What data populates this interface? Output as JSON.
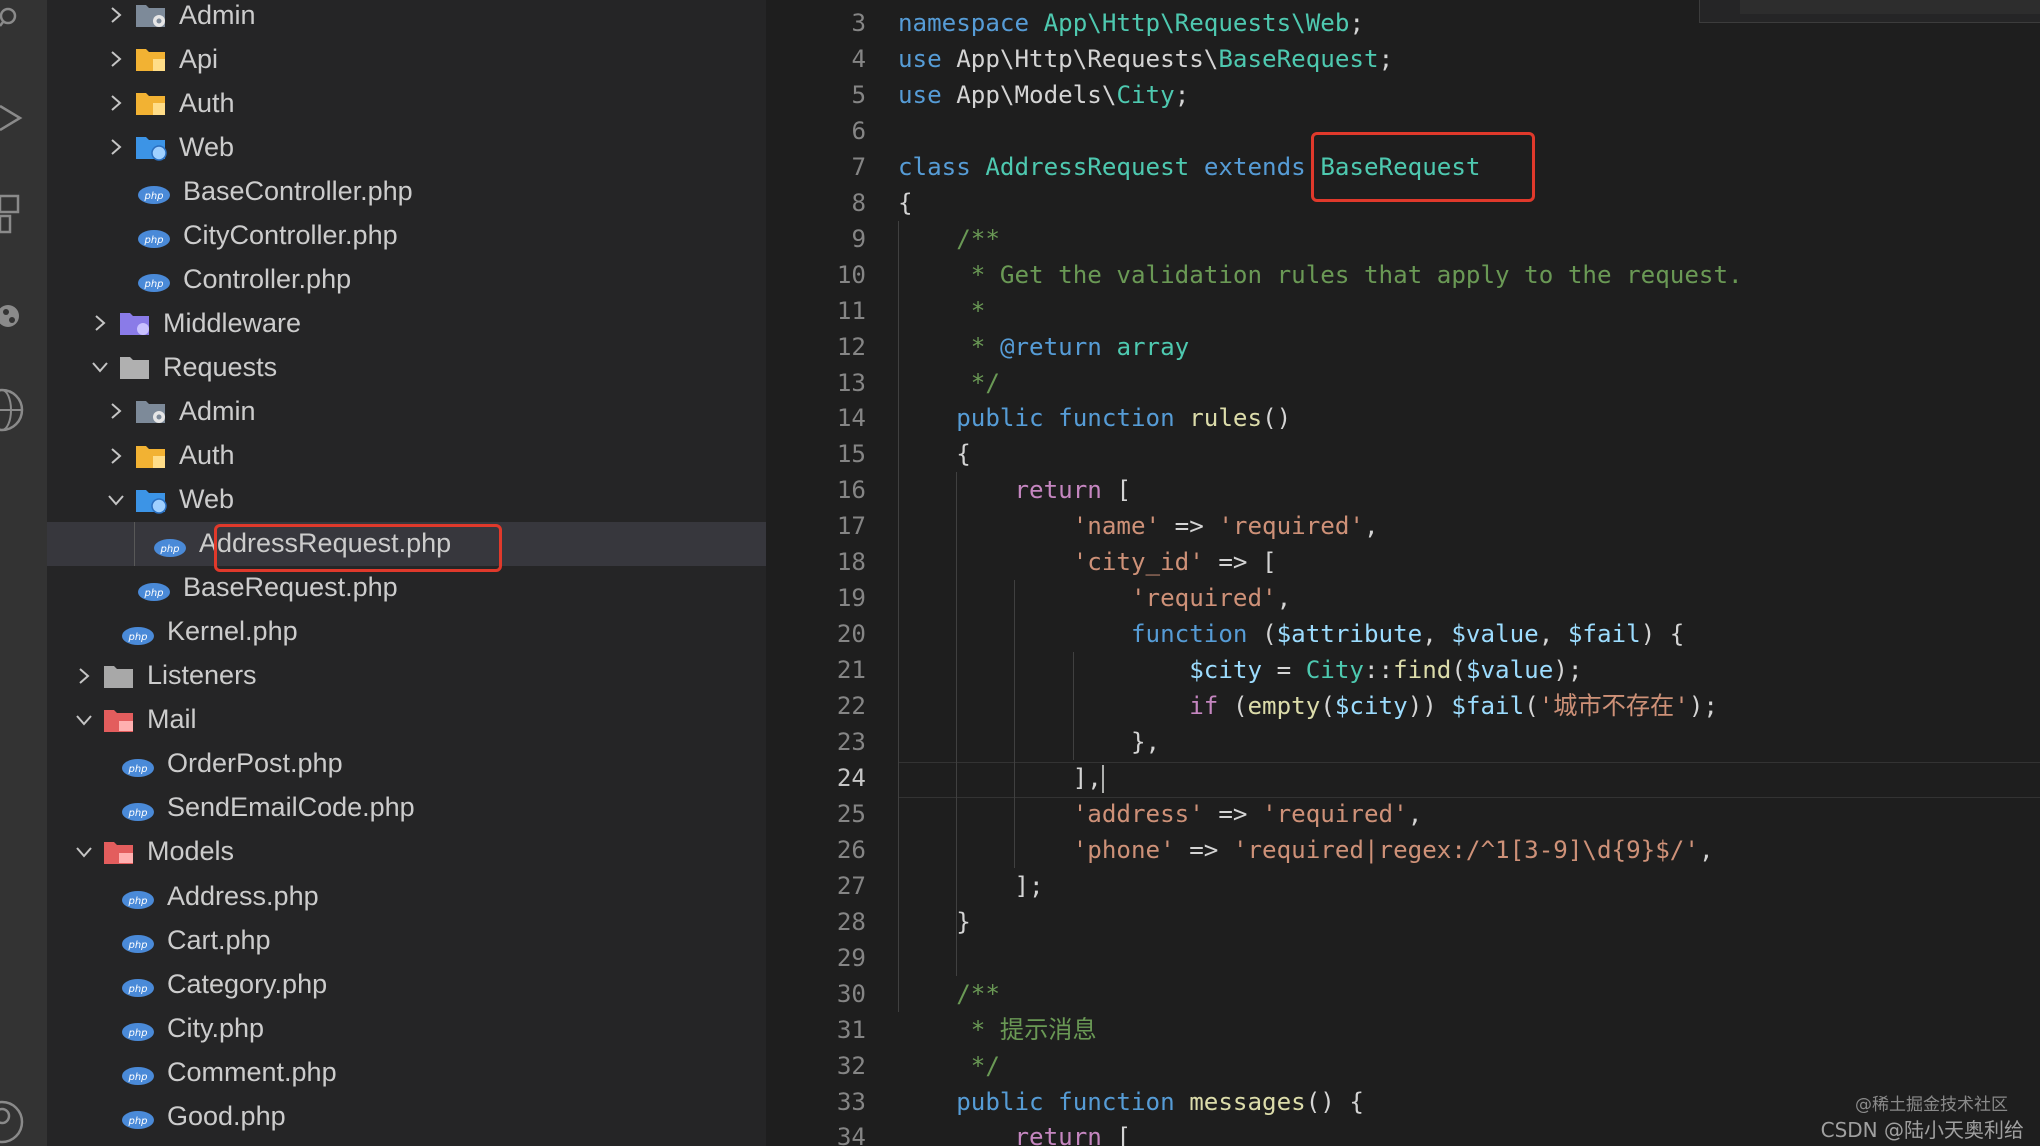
{
  "explorer": {
    "items": [
      {
        "label": "Admin",
        "kind": "folder-admin",
        "depth": 1,
        "expanded": false
      },
      {
        "label": "Api",
        "kind": "folder-api",
        "depth": 1,
        "expanded": false
      },
      {
        "label": "Auth",
        "kind": "folder-auth",
        "depth": 1,
        "expanded": false
      },
      {
        "label": "Web",
        "kind": "folder-web",
        "depth": 1,
        "expanded": false
      },
      {
        "label": "BaseController.php",
        "kind": "php",
        "depth": 1
      },
      {
        "label": "CityController.php",
        "kind": "php",
        "depth": 1
      },
      {
        "label": "Controller.php",
        "kind": "php",
        "depth": 1
      },
      {
        "label": "Middleware",
        "kind": "folder-middleware",
        "depth": 0,
        "expanded": false
      },
      {
        "label": "Requests",
        "kind": "folder-open",
        "depth": 0,
        "expanded": true
      },
      {
        "label": "Admin",
        "kind": "folder-admin",
        "depth": 1,
        "expanded": false
      },
      {
        "label": "Auth",
        "kind": "folder-auth",
        "depth": 1,
        "expanded": false
      },
      {
        "label": "Web",
        "kind": "folder-web",
        "depth": 1,
        "expanded": true
      },
      {
        "label": "AddressRequest.php",
        "kind": "php",
        "depth": 2,
        "selected": true,
        "highlighted": true
      },
      {
        "label": "BaseRequest.php",
        "kind": "php",
        "depth": 1
      },
      {
        "label": "Kernel.php",
        "kind": "php",
        "depth": 0
      },
      {
        "label": "Listeners",
        "kind": "folder-plain",
        "depth": -1,
        "expanded": false
      },
      {
        "label": "Mail",
        "kind": "folder-mail",
        "depth": -1,
        "expanded": true
      },
      {
        "label": "OrderPost.php",
        "kind": "php",
        "depth": 0
      },
      {
        "label": "SendEmailCode.php",
        "kind": "php",
        "depth": 0
      },
      {
        "label": "Models",
        "kind": "folder-models",
        "depth": -1,
        "expanded": true
      },
      {
        "label": "Address.php",
        "kind": "php",
        "depth": 0
      },
      {
        "label": "Cart.php",
        "kind": "php",
        "depth": 0
      },
      {
        "label": "Category.php",
        "kind": "php",
        "depth": 0
      },
      {
        "label": "City.php",
        "kind": "php",
        "depth": 0
      },
      {
        "label": "Comment.php",
        "kind": "php",
        "depth": 0
      },
      {
        "label": "Good.php",
        "kind": "php",
        "depth": 0
      }
    ]
  },
  "editor": {
    "current_line": 24,
    "line_numbers": [
      "3",
      "4",
      "5",
      "6",
      "7",
      "8",
      "9",
      "10",
      "11",
      "12",
      "13",
      "14",
      "15",
      "16",
      "17",
      "18",
      "19",
      "20",
      "21",
      "22",
      "23",
      "24",
      "25",
      "26",
      "27",
      "28",
      "29",
      "30",
      "31",
      "32",
      "33",
      "34"
    ],
    "lines": [
      [
        [
          "k",
          "namespace "
        ],
        [
          "t",
          "App\\Http\\Requests\\Web"
        ],
        [
          "d",
          ";"
        ]
      ],
      [
        [
          "k",
          "use "
        ],
        [
          "d",
          "App\\Http\\Requests\\"
        ],
        [
          "t",
          "BaseRequest"
        ],
        [
          "d",
          ";"
        ]
      ],
      [
        [
          "k",
          "use "
        ],
        [
          "d",
          "App\\Models\\"
        ],
        [
          "t",
          "City"
        ],
        [
          "d",
          ";"
        ]
      ],
      [],
      [
        [
          "k",
          "class "
        ],
        [
          "t",
          "AddressRequest "
        ],
        [
          "k",
          "extends "
        ],
        [
          "t",
          "BaseRequest"
        ]
      ],
      [
        [
          "d",
          "{"
        ]
      ],
      [
        [
          "c",
          "    /**"
        ]
      ],
      [
        [
          "c",
          "     * Get the validation rules that apply to the request."
        ]
      ],
      [
        [
          "c",
          "     *"
        ]
      ],
      [
        [
          "c",
          "     * "
        ],
        [
          "k",
          "@return "
        ],
        [
          "t",
          "array"
        ]
      ],
      [
        [
          "c",
          "     */"
        ]
      ],
      [
        [
          "k",
          "    public function "
        ],
        [
          "f",
          "rules"
        ],
        [
          "d",
          "()"
        ]
      ],
      [
        [
          "d",
          "    {"
        ]
      ],
      [
        [
          "kc",
          "        return "
        ],
        [
          "d",
          "["
        ]
      ],
      [
        [
          "s",
          "            'name'"
        ],
        [
          "d",
          " => "
        ],
        [
          "s",
          "'required'"
        ],
        [
          "d",
          ","
        ]
      ],
      [
        [
          "s",
          "            'city_id'"
        ],
        [
          "d",
          " => ["
        ]
      ],
      [
        [
          "s",
          "                'required'"
        ],
        [
          "d",
          ","
        ]
      ],
      [
        [
          "k",
          "                function "
        ],
        [
          "d",
          "("
        ],
        [
          "v",
          "$attribute"
        ],
        [
          "d",
          ", "
        ],
        [
          "v",
          "$value"
        ],
        [
          "d",
          ", "
        ],
        [
          "v",
          "$fail"
        ],
        [
          "d",
          ") {"
        ]
      ],
      [
        [
          "v",
          "                    $city"
        ],
        [
          "d",
          " = "
        ],
        [
          "t",
          "City"
        ],
        [
          "d",
          "::"
        ],
        [
          "f",
          "find"
        ],
        [
          "d",
          "("
        ],
        [
          "v",
          "$value"
        ],
        [
          "d",
          ");"
        ]
      ],
      [
        [
          "kc",
          "                    if "
        ],
        [
          "d",
          "("
        ],
        [
          "f",
          "empty"
        ],
        [
          "d",
          "("
        ],
        [
          "v",
          "$city"
        ],
        [
          "d",
          ")) "
        ],
        [
          "v",
          "$fail"
        ],
        [
          "d",
          "("
        ],
        [
          "s",
          "'城市不存在'"
        ],
        [
          "d",
          ");"
        ]
      ],
      [
        [
          "d",
          "                },"
        ]
      ],
      [
        [
          "d",
          "            ],"
        ]
      ],
      [
        [
          "s",
          "            'address'"
        ],
        [
          "d",
          " => "
        ],
        [
          "s",
          "'required'"
        ],
        [
          "d",
          ","
        ]
      ],
      [
        [
          "s",
          "            'phone'"
        ],
        [
          "d",
          " => "
        ],
        [
          "s",
          "'required|regex:/^1[3-9]\\d{9}$/'"
        ],
        [
          "d",
          ","
        ]
      ],
      [
        [
          "d",
          "        ];"
        ]
      ],
      [
        [
          "d",
          "    }"
        ]
      ],
      [],
      [
        [
          "c",
          "    /**"
        ]
      ],
      [
        [
          "c",
          "     * 提示消息"
        ]
      ],
      [
        [
          "c",
          "     */"
        ]
      ],
      [
        [
          "k",
          "    public function "
        ],
        [
          "f",
          "messages"
        ],
        [
          "d",
          "() {"
        ]
      ],
      [
        [
          "kc",
          "        return "
        ],
        [
          "d",
          "["
        ]
      ]
    ]
  },
  "watermark": {
    "line1": "@稀土掘金技术社区",
    "line2": "CSDN @陆小天奥利给"
  },
  "colors": {
    "highlight_box": "#e0392b",
    "keyword": "#569cd6",
    "type": "#4ec9b0",
    "string": "#ce9178",
    "comment": "#6a9955",
    "variable": "#9cdcfe",
    "function": "#dcdcaa",
    "control": "#c586c0"
  }
}
